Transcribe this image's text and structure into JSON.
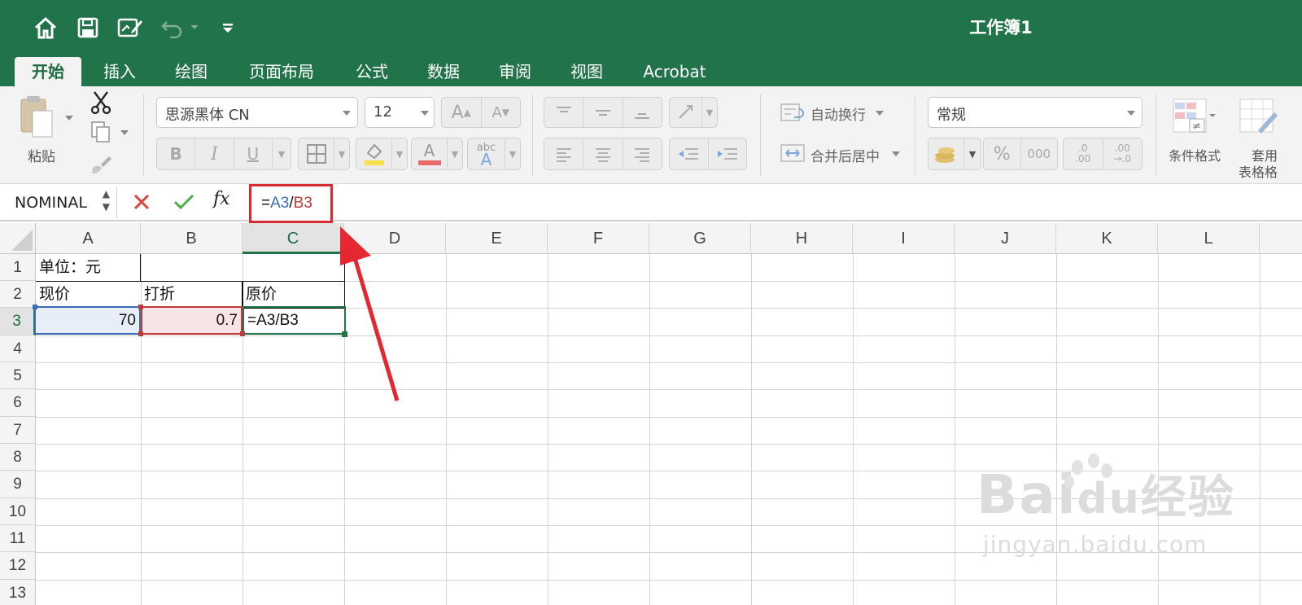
{
  "window": {
    "title": "工作簿1"
  },
  "quick_access": {
    "items": [
      "home-icon",
      "save-icon",
      "edit-icon",
      "undo-icon",
      "customize-icon"
    ]
  },
  "tabs": [
    {
      "label": "开始",
      "active": true
    },
    {
      "label": "插入"
    },
    {
      "label": "绘图"
    },
    {
      "label": "页面布局"
    },
    {
      "label": "公式"
    },
    {
      "label": "数据"
    },
    {
      "label": "审阅"
    },
    {
      "label": "视图"
    },
    {
      "label": "Acrobat"
    }
  ],
  "ribbon": {
    "paste_label": "粘贴",
    "font_name": "思源黑体 CN",
    "font_size": "12",
    "grow_font": "A",
    "shrink_font": "A",
    "bold": "B",
    "italic": "I",
    "underline": "U",
    "font_color_letter": "A",
    "abc_label": "abc",
    "abc_a": "A",
    "wrap_text": "自动换行",
    "merge_center": "合并后居中",
    "number_format": "常规",
    "percent": "%",
    "thousands": "000",
    "inc_dec_top": ".0",
    "inc_dec_bottom": ".00",
    "dec_dec_top": ".00",
    "dec_dec_bottom": "→.0",
    "conditional_format": "条件格式",
    "table_format_1": "套用",
    "table_format_2": "表格格"
  },
  "formula_bar": {
    "name_box": "NOMINAL",
    "fx": "fx",
    "formula_eq": "=",
    "formula_ref1": "A3",
    "formula_op": "/",
    "formula_ref2": "B3"
  },
  "sheet": {
    "columns": [
      "A",
      "B",
      "C",
      "D",
      "E",
      "F",
      "G",
      "H",
      "I",
      "J",
      "K",
      "L"
    ],
    "rows": [
      "1",
      "2",
      "3",
      "4",
      "5",
      "6",
      "7",
      "8",
      "9",
      "10",
      "11",
      "12",
      "13"
    ],
    "cells": {
      "A1": "单位：元",
      "A2": "现价",
      "B2": "打折",
      "C2": "原价",
      "A3": "70",
      "B3": "0.7",
      "C3": "=A3/B3"
    },
    "selected_cell": "C3"
  },
  "watermark": {
    "brand_1": "Bai",
    "brand_2": "du",
    "brand_cn": "经验",
    "url": "jingyan.baidu.com"
  },
  "colors": {
    "title_bar": "#21734a",
    "ref1": "#3c6cb4",
    "ref2": "#c0393b",
    "highlight": "#d52b33"
  }
}
